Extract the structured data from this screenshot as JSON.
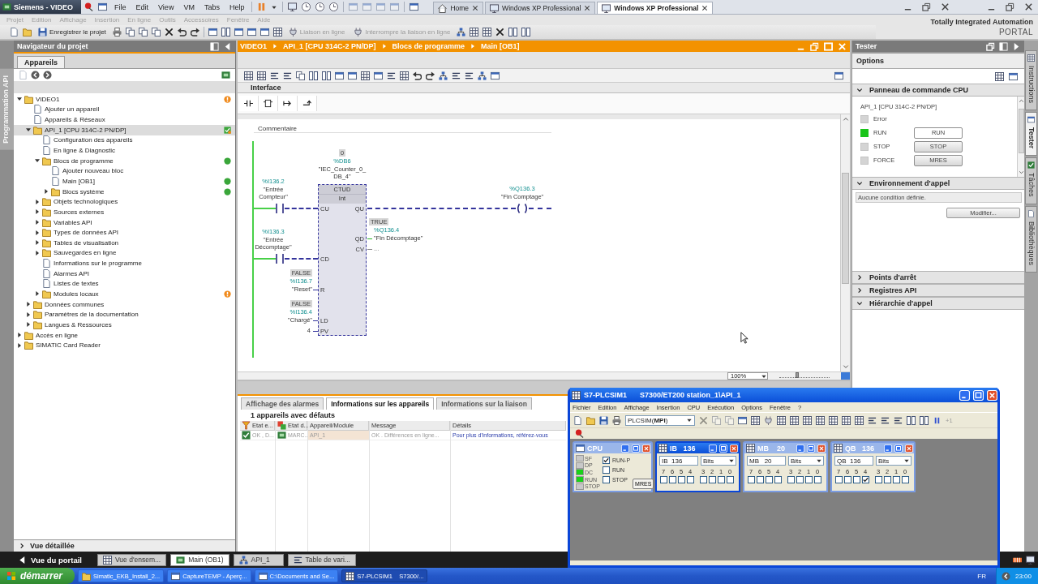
{
  "vm_bar": {
    "window_title": "Siemens - VIDEO",
    "menu": [
      "File",
      "Edit",
      "View",
      "VM",
      "Tabs",
      "Help"
    ],
    "tabs": [
      {
        "label": "Home",
        "selected": false
      },
      {
        "label": "Windows XP Professional",
        "selected": false
      },
      {
        "label": "Windows XP Professional",
        "selected": true
      }
    ]
  },
  "tia_menu": [
    {
      "label": "Projet",
      "disabled": true
    },
    {
      "label": "Edition",
      "disabled": true
    },
    {
      "label": "Affichage",
      "disabled": true
    },
    {
      "label": "Insertion",
      "disabled": true
    },
    {
      "label": "En ligne",
      "disabled": true
    },
    {
      "label": "Outils",
      "disabled": true
    },
    {
      "label": "Accessoires",
      "disabled": true
    },
    {
      "label": "Fenêtre",
      "disabled": true
    },
    {
      "label": "Aide",
      "disabled": true
    }
  ],
  "tia_toolbar": [
    {
      "label": "Enregistrer le projet",
      "disabled": false
    },
    {
      "label": "Liaison en ligne",
      "disabled": true
    },
    {
      "label": "Interrompre la liaison en ligne",
      "disabled": true
    }
  ],
  "brand": {
    "name": "Totally Integrated Automation",
    "product": "PORTAL"
  },
  "left_strip": {
    "label": "Programmation API"
  },
  "navigator": {
    "title": "Navigateur du projet",
    "tab": "Appareils",
    "tree": [
      {
        "label": "VIDEO1",
        "expanded": true,
        "warning": true,
        "selected": false,
        "children": [
          {
            "label": "Ajouter un appareil",
            "selected": false
          },
          {
            "label": "Appareils & Réseaux",
            "selected": false
          },
          {
            "label": "API_1 [CPU 314C-2 PN/DP]",
            "expanded": true,
            "connected": true,
            "selected": true,
            "children": [
              {
                "label": "Configuration des appareils",
                "selected": false
              },
              {
                "label": "En ligne & Diagnostic",
                "selected": false
              },
              {
                "label": "Blocs de programme",
                "expanded": true,
                "consistent": true,
                "selected": false,
                "children": [
                  {
                    "label": "Ajouter nouveau bloc",
                    "selected": false
                  },
                  {
                    "label": "Main [OB1]",
                    "consistent": true,
                    "selected": false
                  },
                  {
                    "label": "Blocs système",
                    "expanded": false,
                    "consistent": true,
                    "selected": false
                  }
                ]
              },
              {
                "label": "Objets technologiques",
                "expanded": false,
                "selected": false
              },
              {
                "label": "Sources externes",
                "expanded": false,
                "selected": false
              },
              {
                "label": "Variables API",
                "expanded": false,
                "selected": false
              },
              {
                "label": "Types de données API",
                "expanded": false,
                "selected": false
              },
              {
                "label": "Tables de visualisation",
                "expanded": false,
                "selected": false
              },
              {
                "label": "Sauvegardes en ligne",
                "expanded": false,
                "selected": false
              },
              {
                "label": "Informations sur le programme",
                "selected": false
              },
              {
                "label": "Alarmes API",
                "selected": false
              },
              {
                "label": "Listes de textes",
                "selected": false
              },
              {
                "label": "Modules locaux",
                "expanded": false,
                "warning": true,
                "selected": false
              }
            ]
          },
          {
            "label": "Données communes",
            "expanded": false,
            "selected": false
          },
          {
            "label": "Paramètres de la documentation",
            "expanded": false,
            "selected": false
          },
          {
            "label": "Langues & Ressources",
            "expanded": false,
            "selected": false
          }
        ]
      },
      {
        "label": "Accès en ligne",
        "expanded": false,
        "selected": false
      },
      {
        "label": "SIMATIC Card Reader",
        "expanded": false,
        "selected": false
      }
    ],
    "detail_view": {
      "label": "Vue détaillée",
      "expanded": false
    }
  },
  "editor": {
    "breadcrumb": [
      "VIDEO1",
      "API_1 [CPU 314C-2 PN/DP]",
      "Blocs de programme",
      "Main [OB1]"
    ],
    "interface_label": "Interface",
    "network": {
      "comment": "Commentaire",
      "block": {
        "instance_value": "0",
        "instance_address": "%DB6",
        "instance_name_lines": [
          "\"IEC_Counter_0_",
          "DB_4\""
        ],
        "type": "CTUD",
        "data_type": "Int"
      },
      "inputs": [
        {
          "kind": "contact",
          "pin": "CU",
          "address": "%I136.2",
          "name": "\"Entrée Compteur\""
        },
        {
          "kind": "contact",
          "pin": "CD",
          "address": "%I136.3",
          "name": "\"Entrée Décomptage\""
        },
        {
          "kind": "variable",
          "pin": "R",
          "value": "FALSE",
          "address": "%I136.7",
          "name": "\"Reset\""
        },
        {
          "kind": "variable",
          "pin": "LD",
          "value": "FALSE",
          "address": "%I136.4",
          "name": "\"Chargé\""
        },
        {
          "kind": "constant",
          "pin": "PV",
          "value": "4"
        }
      ],
      "outputs": [
        {
          "kind": "coil",
          "pin": "QU",
          "address": "%Q136.3",
          "name": "\"Fin Comptage\""
        },
        {
          "kind": "variable",
          "pin": "QD",
          "value": "TRUE",
          "address": "%Q136.4",
          "name": "\"Fin Décomptage\""
        },
        {
          "kind": "empty",
          "pin": "CV",
          "value": "..."
        }
      ]
    },
    "zoom": "100%",
    "zoom_slider": {
      "level": 0.35
    }
  },
  "inspector": {
    "tabs": [
      {
        "label": "Affichage des alarmes",
        "selected": false
      },
      {
        "label": "Informations sur les appareils",
        "selected": true
      },
      {
        "label": "Informations sur la liaison",
        "selected": false
      }
    ],
    "summary": "1 appareils avec défauts",
    "columns": [
      "Etat e...",
      "Etat d...",
      "Appareil/Module",
      "Message",
      "Détails"
    ],
    "rows": [
      {
        "cells": [
          "OK , D...",
          "MARC...",
          "API_1",
          "OK . Différences en ligne...",
          "Pour plus d'informations, référez-vous"
        ]
      }
    ]
  },
  "tester": {
    "title": "Tester",
    "options_label": "Options",
    "cpu_panel": {
      "title": "Panneau de commande CPU",
      "expanded": true,
      "device": "API_1 [CPU 314C-2 PN/DP]",
      "leds": [
        {
          "label": "Error",
          "on": false
        },
        {
          "label": "RUN",
          "on": true
        },
        {
          "label": "STOP",
          "on": false
        },
        {
          "label": "FORCE",
          "on": false
        }
      ],
      "buttons": [
        {
          "label": "RUN",
          "selected": true
        },
        {
          "label": "STOP",
          "selected": false
        },
        {
          "label": "MRES",
          "selected": false
        }
      ]
    },
    "call_environment": {
      "title": "Environnement d'appel",
      "expanded": true,
      "value": "Aucune condition définie.",
      "button": "Modifier..."
    },
    "sections": [
      {
        "title": "Points d'arrêt",
        "expanded": false
      },
      {
        "title": "Registres API",
        "expanded": false
      },
      {
        "title": "Hiérarchie d'appel",
        "expanded": true
      }
    ]
  },
  "side_tabs": [
    {
      "label": "Instructions",
      "selected": false
    },
    {
      "label": "Tester",
      "selected": true
    },
    {
      "label": "Tâches",
      "selected": false
    },
    {
      "label": "Bibliothèques",
      "selected": false
    }
  ],
  "portal_bar": {
    "back_label": "Vue du portail",
    "tabs": [
      {
        "label": "Vue d'ensem...",
        "selected": false
      },
      {
        "label": "Main (OB1)",
        "selected": true
      },
      {
        "label": "API_1",
        "selected": false
      },
      {
        "label": "Table de vari...",
        "selected": false
      }
    ]
  },
  "plcsim": {
    "title": "S7-PLCSIM1",
    "subtitle": "S7300/ET200 station_1\\API_1",
    "menu": [
      "Fichier",
      "Edition",
      "Affichage",
      "Insertion",
      "CPU",
      "Exécution",
      "Options",
      "Fenêtre",
      "?"
    ],
    "connection": "PLCSIM(**MPI**)",
    "step_label": "+1",
    "cpu": {
      "title": "CPU",
      "active": false,
      "leds": [
        {
          "label": "SF",
          "on": false
        },
        {
          "label": "DP",
          "on": false
        },
        {
          "label": "DC",
          "on": true
        },
        {
          "label": "RUN",
          "on": true
        },
        {
          "label": "STOP",
          "on": false
        }
      ],
      "modes": [
        {
          "label": "RUN-P",
          "checked": true
        },
        {
          "label": "RUN",
          "checked": false
        },
        {
          "label": "STOP",
          "checked": false
        }
      ],
      "button": "MRES"
    },
    "monitors": [
      {
        "title": "IB   136",
        "address": "IB  136",
        "format": "Bits",
        "active": true,
        "bits": [
          {
            "label": "7",
            "checked": false
          },
          {
            "label": "6",
            "checked": false
          },
          {
            "label": "5",
            "checked": false
          },
          {
            "label": "4",
            "checked": false
          },
          {
            "label": "3",
            "checked": false
          },
          {
            "label": "2",
            "checked": false
          },
          {
            "label": "1",
            "checked": false
          },
          {
            "label": "0",
            "checked": false
          }
        ]
      },
      {
        "title": "MB    20",
        "address": "MB   20",
        "format": "Bits",
        "active": false,
        "bits": [
          {
            "label": "7",
            "checked": false
          },
          {
            "label": "6",
            "checked": false
          },
          {
            "label": "5",
            "checked": false
          },
          {
            "label": "4",
            "checked": false
          },
          {
            "label": "3",
            "checked": false
          },
          {
            "label": "2",
            "checked": false
          },
          {
            "label": "1",
            "checked": false
          },
          {
            "label": "0",
            "checked": false
          }
        ]
      },
      {
        "title": "QB   136",
        "address": "QB  136",
        "format": "Bits",
        "active": false,
        "bits": [
          {
            "label": "7",
            "checked": false
          },
          {
            "label": "6",
            "checked": false
          },
          {
            "label": "5",
            "checked": false
          },
          {
            "label": "4",
            "checked": true
          },
          {
            "label": "3",
            "checked": false
          },
          {
            "label": "2",
            "checked": false
          },
          {
            "label": "1",
            "checked": false
          },
          {
            "label": "0",
            "checked": false
          }
        ]
      }
    ]
  },
  "taskbar": {
    "start": "démarrer",
    "tasks": [
      {
        "label": "Simatic_EKB_Install_2...",
        "selected": false
      },
      {
        "label": "CaptureTEMP - Aperç...",
        "selected": false
      },
      {
        "label": "C:\\Documents and Se...",
        "selected": false
      },
      {
        "label": "S7-PLCSIM1    S7300/...",
        "selected": true
      }
    ],
    "language": "FR",
    "clock": "23:00"
  }
}
